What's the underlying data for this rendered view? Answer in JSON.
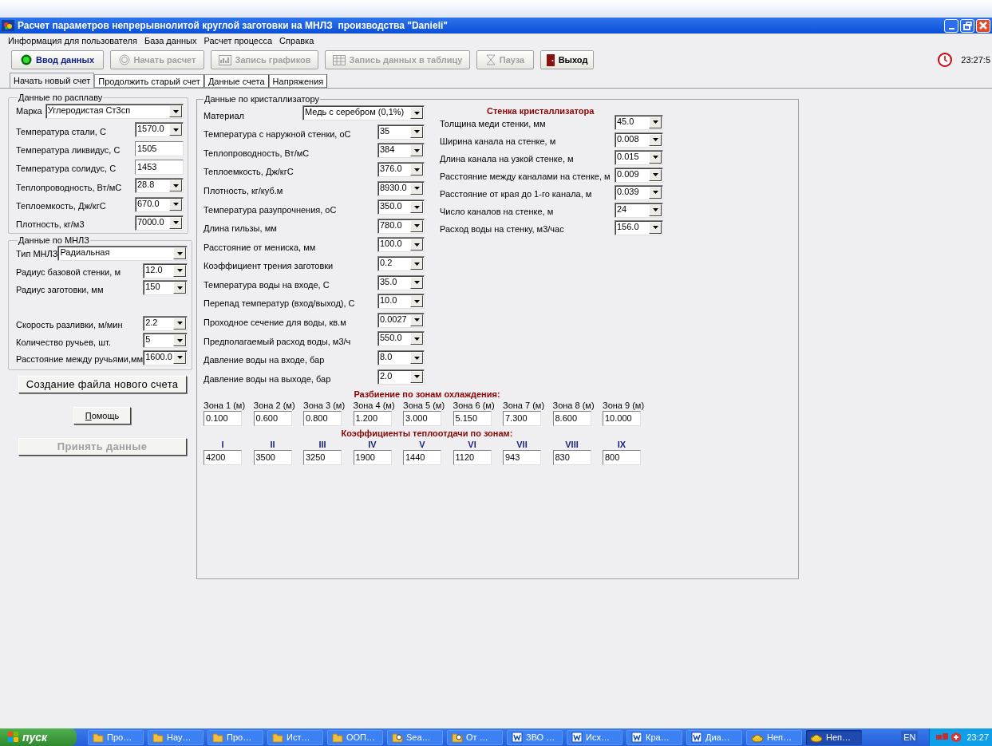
{
  "window": {
    "title": "Расчет параметров непрерывнолитой круглой заготовки на МНЛЗ  производства \"Danieli\""
  },
  "menu": [
    "Информация для пользователя",
    "База данных",
    "Расчет процесса",
    "Справка"
  ],
  "toolbar": [
    {
      "label": "Ввод данных",
      "kind": "input",
      "disabled": false
    },
    {
      "label": "Начать расчет",
      "kind": "start",
      "disabled": true
    },
    {
      "label": "Запись графиков",
      "kind": "chart",
      "disabled": true
    },
    {
      "label": "Запись данных в таблицу",
      "kind": "table",
      "disabled": true
    },
    {
      "label": "Пауза",
      "kind": "pause",
      "disabled": true
    },
    {
      "label": "Выход",
      "kind": "exit",
      "disabled": false
    }
  ],
  "clock": "23:27:5",
  "tabs": [
    {
      "label": "Начать новый счет",
      "selected": true
    },
    {
      "label": "Продолжить старый счет",
      "selected": false
    },
    {
      "label": "Данные счета",
      "selected": false
    },
    {
      "label": "Напряжения",
      "selected": false
    }
  ],
  "melt": {
    "title": "Данные по расплаву",
    "fields": [
      {
        "label": "Марка",
        "value": "Углеродистая Ст3сп",
        "kind": "wide"
      },
      {
        "label": "Температура стали, С",
        "value": "1570.0",
        "kind": "combo"
      },
      {
        "label": "Температура ликвидус, С",
        "value": "1505",
        "kind": "text"
      },
      {
        "label": "Температура солидус, С",
        "value": "1453",
        "kind": "text"
      },
      {
        "label": "Теплопроводность, Вт/мС",
        "value": "28.8",
        "kind": "combo"
      },
      {
        "label": "Теплоемкость, Дж/кгС",
        "value": "670.0",
        "kind": "combo"
      },
      {
        "label": "Плотность, кг/м3",
        "value": "7000.0",
        "kind": "combo"
      }
    ]
  },
  "ccm": {
    "title": "Данные по МНЛЗ",
    "fields": [
      {
        "label": "Тип МНЛЗ",
        "value": "Радиальная",
        "kind": "wide"
      },
      {
        "label": "Радиус базовой стенки, м",
        "value": "12.0",
        "kind": "combo"
      },
      {
        "label": "Радиус заготовки, мм",
        "value": "150",
        "kind": "combo"
      },
      {
        "label": "Скорость  разливки, м/мин",
        "value": "2.2",
        "kind": "combo"
      },
      {
        "label": "Количество ручьев, шт.",
        "value": "5",
        "kind": "combo"
      },
      {
        "label": "Расстояние между ручьями,мм",
        "value": "1600.0",
        "kind": "combo"
      }
    ]
  },
  "buttons": [
    {
      "label": "Создание файла нового счета",
      "kind": "wide",
      "disabled": false
    },
    {
      "label": "Помощь",
      "kind": "small",
      "disabled": false
    },
    {
      "label": "Принять данные",
      "kind": "wide",
      "disabled": true
    }
  ],
  "mold": {
    "title": "Данные по кристаллизатору",
    "fields": [
      {
        "label": "Материал",
        "value": "Медь с серебром (0,1%)",
        "kind": "wide"
      },
      {
        "label": "Температура с наружной стенки, оС",
        "value": "35",
        "kind": "combo"
      },
      {
        "label": "Теплопроводность, Вт/мС",
        "value": "384",
        "kind": "combo"
      },
      {
        "label": "Теплоемкость, Дж/кгС",
        "value": "376.0",
        "kind": "combo"
      },
      {
        "label": "Плотность, кг/куб.м",
        "value": "8930.0",
        "kind": "combo"
      },
      {
        "label": "Температура разупрочнения, оС",
        "value": "350.0",
        "kind": "combo"
      },
      {
        "label": "Длина гильзы, мм",
        "value": "780.0",
        "kind": "combo"
      },
      {
        "label": "Расстояние от мениска, мм",
        "value": "100.0",
        "kind": "combo"
      },
      {
        "label": "Коэффициент трения заготовки",
        "value": "0.2",
        "kind": "combo"
      },
      {
        "label": "Температура воды на входе, С",
        "value": "35.0",
        "kind": "combo"
      },
      {
        "label": "Перепад температур (вход/выход), С",
        "value": "10.0",
        "kind": "combo"
      },
      {
        "label": "Проходное сечение для воды, кв.м",
        "value": "0.0027",
        "kind": "combo"
      },
      {
        "label": "Предполагаемый расход воды, м3/ч",
        "value": "550.0",
        "kind": "combo"
      },
      {
        "label": "Давление воды на входе, бар",
        "value": "8.0",
        "kind": "combo"
      },
      {
        "label": "Давление воды на выходе, бар",
        "value": "2.0",
        "kind": "combo"
      }
    ]
  },
  "wall": {
    "title": "Стенка кристаллизатора",
    "fields": [
      {
        "label": "Толщина меди стенки, мм",
        "value": "45.0"
      },
      {
        "label": "Ширина канала на стенке, м",
        "value": "0.008"
      },
      {
        "label": "Длина канала на узкой стенке, м",
        "value": "0.015"
      },
      {
        "label": "Расстояние между каналами на стенке, м",
        "value": "0.009"
      },
      {
        "label": "Расстояние от края до 1-го канала, м",
        "value": "0.039"
      },
      {
        "label": "Число каналов на стенке, м",
        "value": "24"
      },
      {
        "label": "Расход воды на стенку, м3/час",
        "value": "156.0"
      }
    ]
  },
  "zones": {
    "title": "Разбиение по зонам охлаждения:",
    "items": [
      {
        "label": "Зона 1 (м)",
        "value": "0.100"
      },
      {
        "label": "Зона 2 (м)",
        "value": "0.600"
      },
      {
        "label": "Зона 3 (м)",
        "value": "0.800"
      },
      {
        "label": "Зона 4 (м)",
        "value": "1.200"
      },
      {
        "label": "Зона 5 (м)",
        "value": "3.000"
      },
      {
        "label": "Зона 6 (м)",
        "value": "5.150"
      },
      {
        "label": "Зона 7 (м)",
        "value": "7.300"
      },
      {
        "label": "Зона 8 (м)",
        "value": "8.600"
      },
      {
        "label": "Зона 9 (м)",
        "value": "10.000"
      }
    ]
  },
  "coefficients": {
    "title": "Коэффициенты теплоотдачи по зонам:",
    "items": [
      {
        "label": "I",
        "value": "4200"
      },
      {
        "label": "II",
        "value": "3500"
      },
      {
        "label": "III",
        "value": "3250"
      },
      {
        "label": "IV",
        "value": "1900"
      },
      {
        "label": "V",
        "value": "1440"
      },
      {
        "label": "VI",
        "value": "1120"
      },
      {
        "label": "VII",
        "value": "943"
      },
      {
        "label": "VIII",
        "value": "830"
      },
      {
        "label": "IX",
        "value": "800"
      }
    ]
  },
  "taskbar": {
    "start": "пуск",
    "items": [
      {
        "label": "Про…",
        "kind": "folder",
        "selected": false
      },
      {
        "label": "Нау…",
        "kind": "folder",
        "selected": false
      },
      {
        "label": "Про…",
        "kind": "folder",
        "selected": false
      },
      {
        "label": "Ист…",
        "kind": "folder",
        "selected": false
      },
      {
        "label": "ООП…",
        "kind": "folder",
        "selected": false
      },
      {
        "label": "Sea…",
        "kind": "search",
        "selected": false
      },
      {
        "label": "От …",
        "kind": "search",
        "selected": false
      },
      {
        "label": "ЗВО …",
        "kind": "word",
        "selected": false
      },
      {
        "label": "Исх…",
        "kind": "word",
        "selected": false
      },
      {
        "label": "Кра…",
        "kind": "word",
        "selected": false
      },
      {
        "label": "Диа…",
        "kind": "word",
        "selected": false
      },
      {
        "label": "Неп…",
        "kind": "app",
        "selected": false
      },
      {
        "label": "Неп…",
        "kind": "app",
        "selected": true
      }
    ],
    "language": "EN",
    "time": "23:27"
  }
}
